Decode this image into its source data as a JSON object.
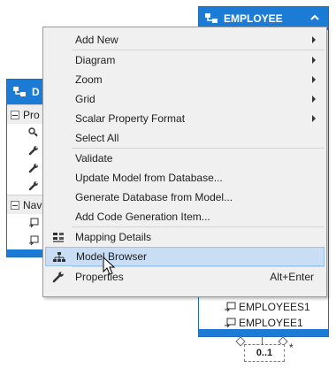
{
  "entity_employee": {
    "title": "EMPLOYEE",
    "nav_items": [
      "EMPLOYEES1",
      "EMPLOYEE1"
    ]
  },
  "entity_left": {
    "title": "D",
    "section_properties": "Pro",
    "section_navigation": "Nav"
  },
  "association": {
    "multiplicity": "0..1",
    "other_end": "*"
  },
  "context_menu": {
    "items": [
      {
        "label": "Add New",
        "submenu": true,
        "icon": null
      },
      {
        "label": "Diagram",
        "submenu": true,
        "icon": null
      },
      {
        "label": "Zoom",
        "submenu": true,
        "icon": null
      },
      {
        "label": "Grid",
        "submenu": true,
        "icon": null
      },
      {
        "label": "Scalar Property Format",
        "submenu": true,
        "icon": null
      },
      {
        "label": "Select All",
        "submenu": false,
        "icon": null
      },
      {
        "label": "Validate",
        "submenu": false,
        "icon": null
      },
      {
        "label": "Update Model from Database...",
        "submenu": false,
        "icon": null
      },
      {
        "label": "Generate Database from Model...",
        "submenu": false,
        "icon": null
      },
      {
        "label": "Add Code Generation Item...",
        "submenu": false,
        "icon": null
      },
      {
        "label": "Mapping Details",
        "submenu": false,
        "icon": "mapping-details-icon"
      },
      {
        "label": "Model Browser",
        "submenu": false,
        "icon": "model-browser-icon",
        "highlighted": true
      },
      {
        "label": "Properties",
        "submenu": false,
        "icon": "wrench-icon",
        "shortcut": "Alt+Enter"
      }
    ]
  },
  "colors": {
    "entity_header": "#1c7cd5",
    "menu_background": "#f0f0f0",
    "menu_highlight": "#c9def5"
  }
}
